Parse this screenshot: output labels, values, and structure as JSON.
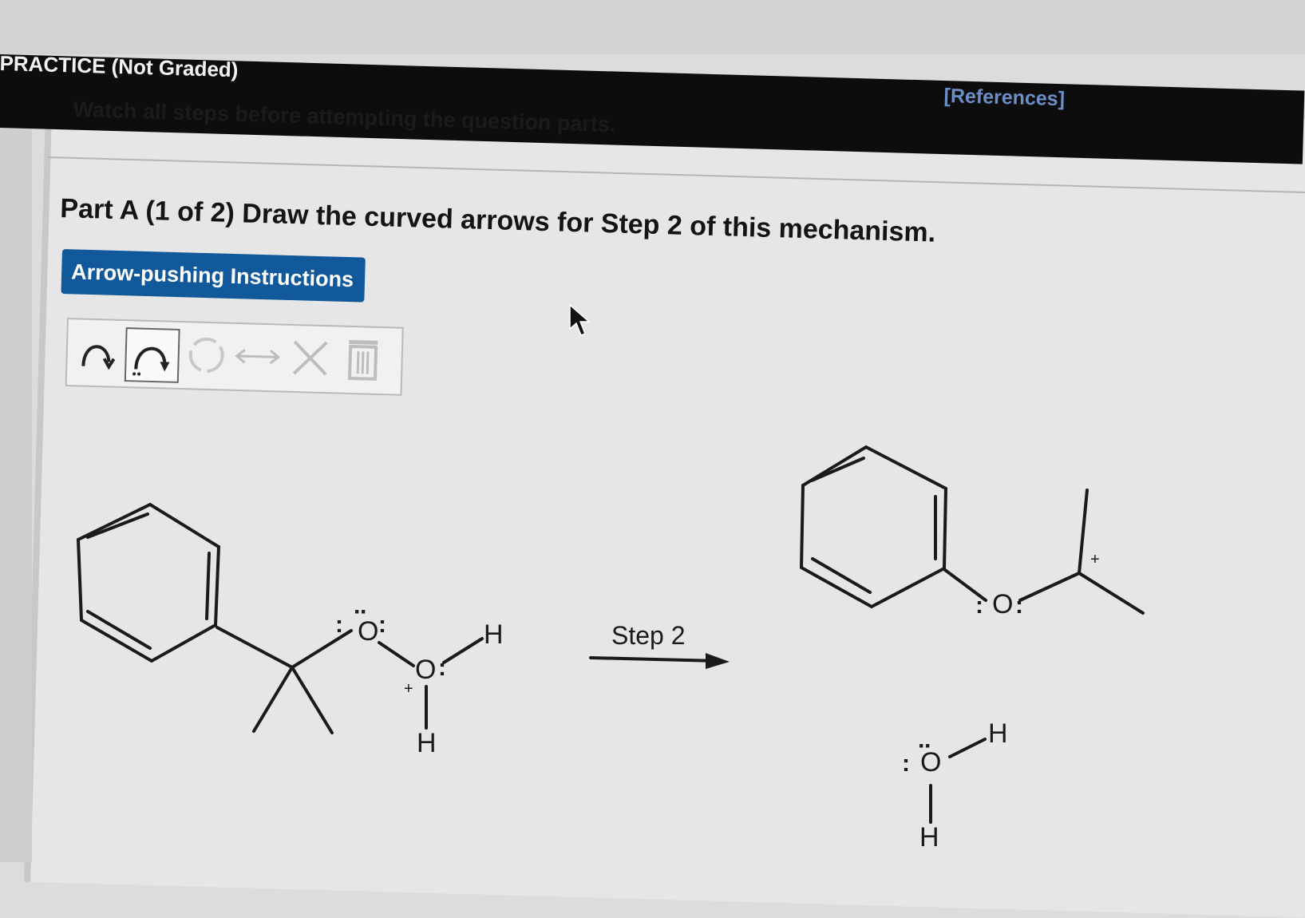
{
  "header": {
    "title": "PRACTICE (Not Graded)",
    "references": "[References]"
  },
  "instructions": {
    "watch": "Watch all steps before attempting the question parts."
  },
  "part": {
    "title": "Part A (1 of 2) Draw the curved arrows for Step 2 of this mechanism."
  },
  "buttons": {
    "arrow_pushing": "Arrow-pushing Instructions"
  },
  "toolbar": {
    "icons": [
      "single-curved-arrow-icon",
      "double-curved-arrow-icon",
      "circle-select-icon",
      "resonance-arrow-icon",
      "delete-x-icon",
      "trash-icon"
    ]
  },
  "mechanism": {
    "reactant": {
      "oxygen": "O",
      "oxonium": "O",
      "h_top": "H",
      "h_bottom": "H",
      "plus": "+"
    },
    "step_label": "Step 2",
    "product": {
      "ether_oxygen": "O",
      "water_oxygen": "O",
      "h_top": "H",
      "h_bottom": "H",
      "plus": "+"
    }
  },
  "colors": {
    "header_bg": "#0d0d0d",
    "button_bg": "#11599a",
    "references": "#6b8ec9"
  }
}
